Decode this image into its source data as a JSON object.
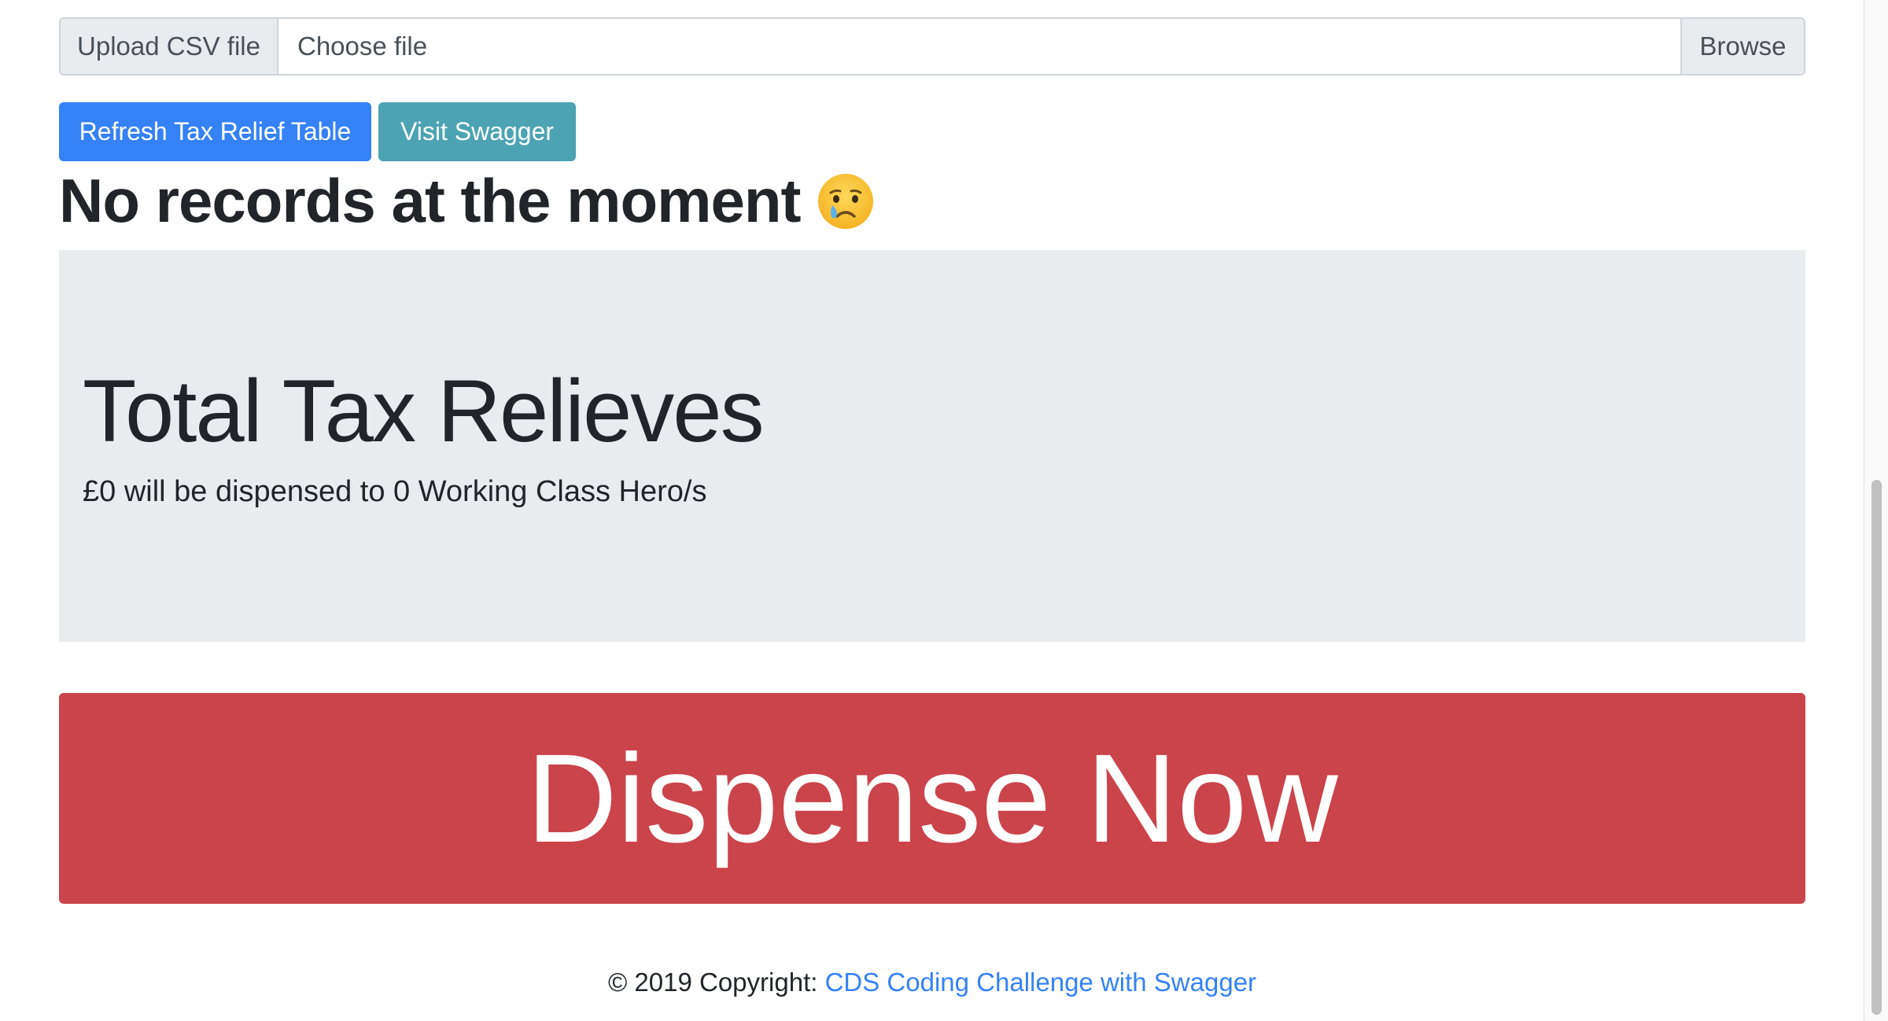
{
  "upload": {
    "label": "Upload CSV file",
    "placeholder": "Choose file",
    "browse_label": "Browse"
  },
  "buttons": {
    "refresh_label": "Refresh Tax Relief Table",
    "swagger_label": "Visit Swagger"
  },
  "status": {
    "heading": "No records at the moment",
    "emoji_icon": "crying-face-icon"
  },
  "summary": {
    "title": "Total Tax Relieves",
    "description": "£0 will be dispensed to 0 Working Class Hero/s"
  },
  "dispense": {
    "label": "Dispense Now"
  },
  "footer": {
    "copyright": "© 2019 Copyright: ",
    "link_text": "CDS Coding Challenge with Swagger"
  },
  "colors": {
    "primary": "#3482f6",
    "info": "#4ca3b3",
    "danger": "#cb444a",
    "jumbotron_bg": "#e9ecef"
  }
}
